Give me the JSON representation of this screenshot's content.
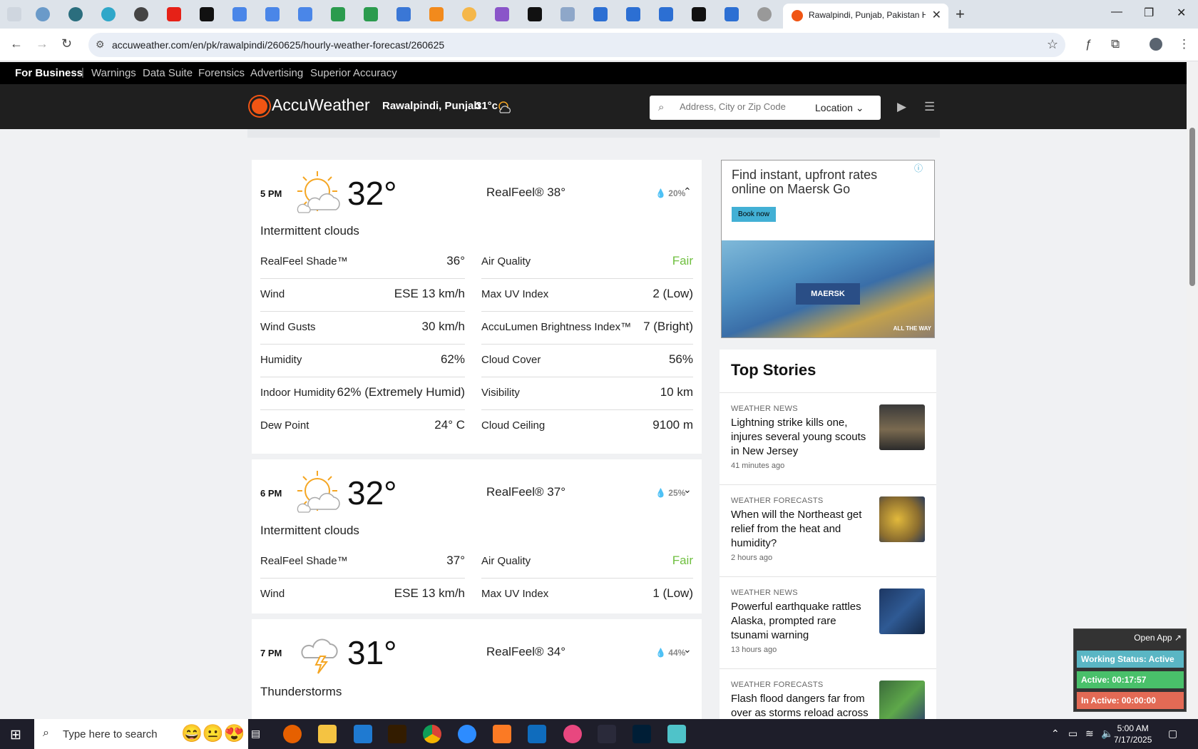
{
  "browser": {
    "active_tab_title": "Rawalpindi, Punjab, Pakistan Hourly Weather Forecast",
    "url": "accuweather.com/en/pk/rawalpindi/260625/hourly-weather-forecast/260625"
  },
  "bizbar": {
    "brand": "For Business",
    "links": [
      "Warnings",
      "Data Suite",
      "Forensics",
      "Advertising",
      "Superior Accuracy"
    ]
  },
  "header": {
    "logo": "AccuWeather",
    "location": "Rawalpindi, Punjab",
    "temp": "31°c",
    "search_placeholder": "Address, City or Zip Code",
    "location_btn": "Location"
  },
  "hours": [
    {
      "time": "5 PM",
      "temp": "32°",
      "realfeel": "RealFeel® 38°",
      "precip": "20%",
      "phrase": "Intermittent clouds",
      "left": [
        [
          "RealFeel Shade™",
          "36°"
        ],
        [
          "Wind",
          "ESE 13 km/h"
        ],
        [
          "Wind Gusts",
          "30 km/h"
        ],
        [
          "Humidity",
          "62%"
        ],
        [
          "Indoor Humidity",
          "62% (Extremely Humid)"
        ],
        [
          "Dew Point",
          "24° C"
        ]
      ],
      "right": [
        [
          "Air Quality",
          "Fair"
        ],
        [
          "Max UV Index",
          "2 (Low)"
        ],
        [
          "AccuLumen Brightness Index™",
          "7 (Bright)"
        ],
        [
          "Cloud Cover",
          "56%"
        ],
        [
          "Visibility",
          "10 km"
        ],
        [
          "Cloud Ceiling",
          "9100 m"
        ]
      ]
    },
    {
      "time": "6 PM",
      "temp": "32°",
      "realfeel": "RealFeel® 37°",
      "precip": "25%",
      "phrase": "Intermittent clouds",
      "left": [
        [
          "RealFeel Shade™",
          "37°"
        ],
        [
          "Wind",
          "ESE 13 km/h"
        ]
      ],
      "right": [
        [
          "Air Quality",
          "Fair"
        ],
        [
          "Max UV Index",
          "1 (Low)"
        ]
      ]
    },
    {
      "time": "7 PM",
      "temp": "31°",
      "realfeel": "RealFeel® 34°",
      "precip": "44%",
      "phrase": "Thunderstorms"
    }
  ],
  "ad": {
    "headline": "Find instant, upfront rates online on Maersk Go",
    "button": "Book now",
    "brand": "MAERSK",
    "tagline": "ALL THE WAY"
  },
  "top_stories": {
    "heading": "Top Stories",
    "items": [
      {
        "category": "WEATHER NEWS",
        "title": "Lightning strike kills one, injures several young scouts in New Jersey",
        "ago": "41 minutes ago"
      },
      {
        "category": "WEATHER FORECASTS",
        "title": "When will the Northeast get relief from the heat and humidity?",
        "ago": "2 hours ago"
      },
      {
        "category": "WEATHER NEWS",
        "title": "Powerful earthquake rattles Alaska, prompted rare tsunami warning",
        "ago": "13 hours ago"
      },
      {
        "category": "WEATHER FORECASTS",
        "title": "Flash flood dangers far from over as storms reload across",
        "ago": ""
      }
    ]
  },
  "widget": {
    "open_app": "Open App ↗",
    "working": "Working Status: Active",
    "active": "Active: 00:17:57",
    "inactive": "In Active: 00:00:00"
  },
  "taskbar": {
    "search_placeholder": "Type here to search",
    "time": "5:00 AM",
    "date": "7/17/2025"
  }
}
